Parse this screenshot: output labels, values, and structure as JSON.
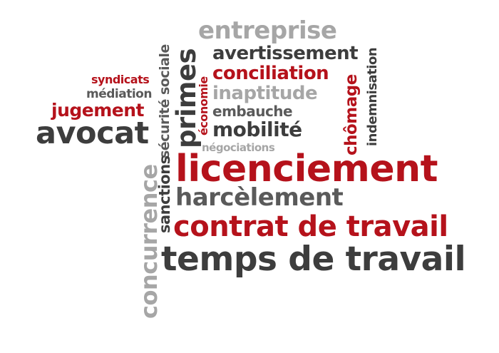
{
  "words": {
    "entreprise": "entreprise",
    "avertissement": "avertissement",
    "conciliation": "conciliation",
    "inaptitude": "inaptitude",
    "embauche": "embauche",
    "mobilite": "mobilité",
    "negociations": "négociations",
    "licenciement": "licenciement",
    "harcelement": "harcèlement",
    "contrat_de_travail": "contrat de travail",
    "temps_de_travail": "temps de travail",
    "syndicats": "syndicats",
    "mediation": "médiation",
    "jugement": "jugement",
    "avocat": "avocat",
    "securite_sociale": "sécurité sociale",
    "primes": "primes",
    "economie": "économie",
    "chomage": "chômage",
    "indemnisation": "indemnisation",
    "sanctions": "sanctions",
    "concurrence": "concurrence"
  },
  "colors": {
    "dark": "#3d3d3d",
    "red": "#b5121b",
    "grey": "#a6a6a6"
  }
}
